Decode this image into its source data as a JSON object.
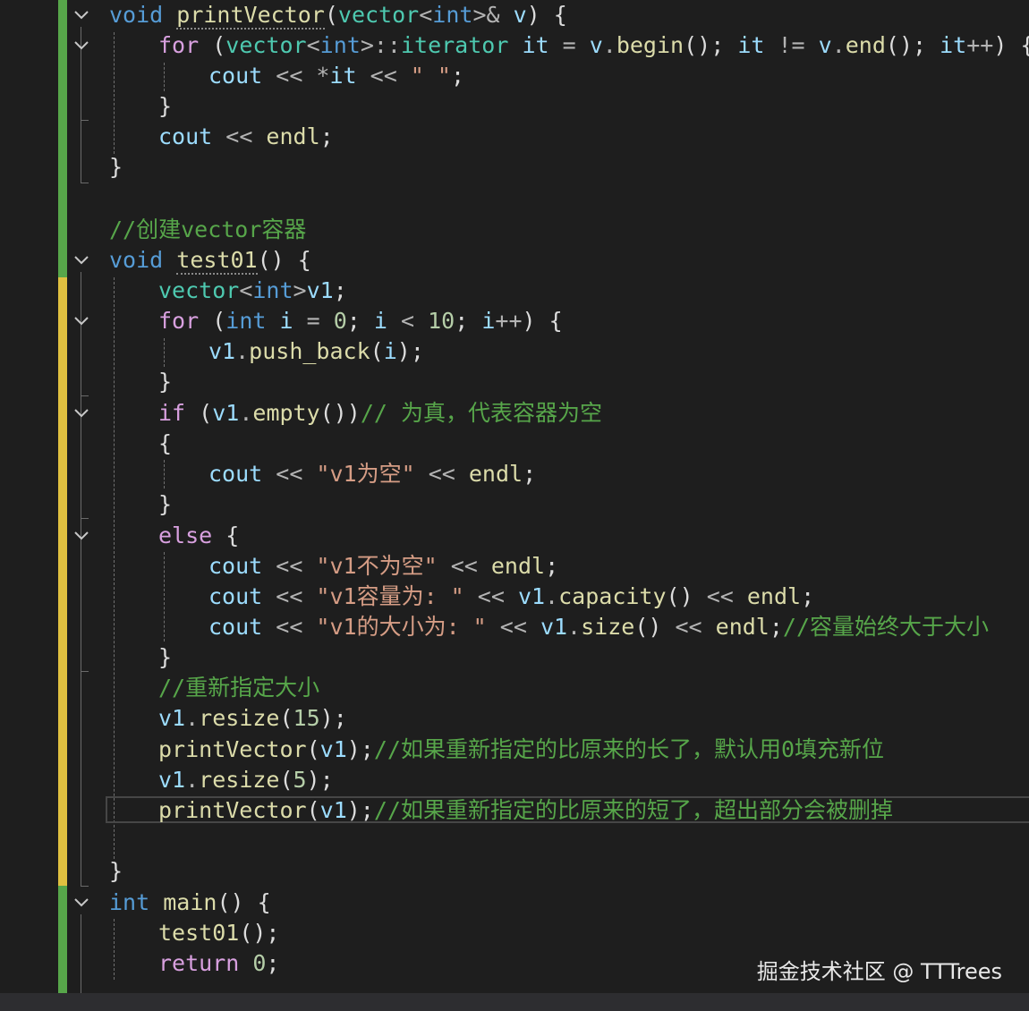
{
  "editor": {
    "lines": [
      [
        [
          "kw",
          "void "
        ],
        [
          "fn",
          "printVector"
        ],
        [
          "pl",
          "("
        ],
        [
          "ty",
          "vector"
        ],
        [
          "op",
          "<"
        ],
        [
          "kw",
          "int"
        ],
        [
          "op",
          ">& "
        ],
        [
          "var",
          "v"
        ],
        [
          "pl",
          ") {"
        ]
      ],
      [
        [
          "ctl",
          "for "
        ],
        [
          "pl",
          "("
        ],
        [
          "ty",
          "vector"
        ],
        [
          "op",
          "<"
        ],
        [
          "kw",
          "int"
        ],
        [
          "op",
          ">::"
        ],
        [
          "ty",
          "iterator "
        ],
        [
          "var",
          "it "
        ],
        [
          "op",
          "= "
        ],
        [
          "var",
          "v"
        ],
        [
          "op",
          "."
        ],
        [
          "fn",
          "begin"
        ],
        [
          "pl",
          "(); "
        ],
        [
          "var",
          "it "
        ],
        [
          "op",
          "!= "
        ],
        [
          "var",
          "v"
        ],
        [
          "op",
          "."
        ],
        [
          "fn",
          "end"
        ],
        [
          "pl",
          "(); "
        ],
        [
          "var",
          "it"
        ],
        [
          "op",
          "++"
        ],
        [
          "pl",
          ") {"
        ]
      ],
      [
        [
          "var",
          "cout "
        ],
        [
          "op",
          "<< *"
        ],
        [
          "var",
          "it "
        ],
        [
          "op",
          "<< "
        ],
        [
          "str",
          "\" \""
        ],
        [
          "pl",
          ";"
        ]
      ],
      [
        [
          "pl",
          "}"
        ]
      ],
      [
        [
          "var",
          "cout "
        ],
        [
          "op",
          "<< "
        ],
        [
          "fn",
          "endl"
        ],
        [
          "pl",
          ";"
        ]
      ],
      [
        [
          "pl",
          "}"
        ]
      ],
      [],
      [
        [
          "cmt",
          "//创建vector容器"
        ]
      ],
      [
        [
          "kw",
          "void "
        ],
        [
          "fn",
          "test01"
        ],
        [
          "pl",
          "() {"
        ]
      ],
      [
        [
          "ty",
          "vector"
        ],
        [
          "op",
          "<"
        ],
        [
          "kw",
          "int"
        ],
        [
          "op",
          ">"
        ],
        [
          "var",
          "v1"
        ],
        [
          "pl",
          ";"
        ]
      ],
      [
        [
          "ctl",
          "for "
        ],
        [
          "pl",
          "("
        ],
        [
          "kw",
          "int "
        ],
        [
          "var",
          "i "
        ],
        [
          "op",
          "= "
        ],
        [
          "num",
          "0"
        ],
        [
          "pl",
          "; "
        ],
        [
          "var",
          "i "
        ],
        [
          "op",
          "< "
        ],
        [
          "num",
          "10"
        ],
        [
          "pl",
          "; "
        ],
        [
          "var",
          "i"
        ],
        [
          "op",
          "++"
        ],
        [
          "pl",
          ") {"
        ]
      ],
      [
        [
          "var",
          "v1"
        ],
        [
          "op",
          "."
        ],
        [
          "fn",
          "push_back"
        ],
        [
          "pl",
          "("
        ],
        [
          "var",
          "i"
        ],
        [
          "pl",
          ");"
        ]
      ],
      [
        [
          "pl",
          "}"
        ]
      ],
      [
        [
          "ctl",
          "if "
        ],
        [
          "pl",
          "("
        ],
        [
          "var",
          "v1"
        ],
        [
          "op",
          "."
        ],
        [
          "fn",
          "empty"
        ],
        [
          "pl",
          "())"
        ],
        [
          "cmt",
          "// 为真，代表容器为空"
        ]
      ],
      [
        [
          "pl",
          "{"
        ]
      ],
      [
        [
          "var",
          "cout "
        ],
        [
          "op",
          "<< "
        ],
        [
          "str",
          "\"v1为空\" "
        ],
        [
          "op",
          "<< "
        ],
        [
          "fn",
          "endl"
        ],
        [
          "pl",
          ";"
        ]
      ],
      [
        [
          "pl",
          "}"
        ]
      ],
      [
        [
          "ctl",
          "else "
        ],
        [
          "pl",
          "{"
        ]
      ],
      [
        [
          "var",
          "cout "
        ],
        [
          "op",
          "<< "
        ],
        [
          "str",
          "\"v1不为空\" "
        ],
        [
          "op",
          "<< "
        ],
        [
          "fn",
          "endl"
        ],
        [
          "pl",
          ";"
        ]
      ],
      [
        [
          "var",
          "cout "
        ],
        [
          "op",
          "<< "
        ],
        [
          "str",
          "\"v1容量为: \" "
        ],
        [
          "op",
          "<< "
        ],
        [
          "var",
          "v1"
        ],
        [
          "op",
          "."
        ],
        [
          "fn",
          "capacity"
        ],
        [
          "pl",
          "() "
        ],
        [
          "op",
          "<< "
        ],
        [
          "fn",
          "endl"
        ],
        [
          "pl",
          ";"
        ]
      ],
      [
        [
          "var",
          "cout "
        ],
        [
          "op",
          "<< "
        ],
        [
          "str",
          "\"v1的大小为: \" "
        ],
        [
          "op",
          "<< "
        ],
        [
          "var",
          "v1"
        ],
        [
          "op",
          "."
        ],
        [
          "fn",
          "size"
        ],
        [
          "pl",
          "() "
        ],
        [
          "op",
          "<< "
        ],
        [
          "fn",
          "endl"
        ],
        [
          "pl",
          ";"
        ],
        [
          "cmt",
          "//容量始终大于大小"
        ]
      ],
      [
        [
          "pl",
          "}"
        ]
      ],
      [
        [
          "cmt",
          "//重新指定大小"
        ]
      ],
      [
        [
          "var",
          "v1"
        ],
        [
          "op",
          "."
        ],
        [
          "fn",
          "resize"
        ],
        [
          "pl",
          "("
        ],
        [
          "num",
          "15"
        ],
        [
          "pl",
          ");"
        ]
      ],
      [
        [
          "fn",
          "printVector"
        ],
        [
          "pl",
          "("
        ],
        [
          "var",
          "v1"
        ],
        [
          "pl",
          ");"
        ],
        [
          "cmt",
          "//如果重新指定的比原来的长了，默认用0填充新位"
        ]
      ],
      [
        [
          "var",
          "v1"
        ],
        [
          "op",
          "."
        ],
        [
          "fn",
          "resize"
        ],
        [
          "pl",
          "("
        ],
        [
          "num",
          "5"
        ],
        [
          "pl",
          ");"
        ]
      ],
      [
        [
          "fn",
          "printVector"
        ],
        [
          "pl",
          "("
        ],
        [
          "var",
          "v1"
        ],
        [
          "pl",
          ");"
        ],
        [
          "cmt",
          "//如果重新指定的比原来的短了，超出部分会被删掉"
        ]
      ],
      [],
      [
        [
          "pl",
          "}"
        ]
      ],
      [
        [
          "kw",
          "int "
        ],
        [
          "fn",
          "main"
        ],
        [
          "pl",
          "() {"
        ]
      ],
      [
        [
          "fn",
          "test01"
        ],
        [
          "pl",
          "();"
        ]
      ],
      [
        [
          "ctl",
          "return "
        ],
        [
          "num",
          "0"
        ],
        [
          "pl",
          ";"
        ]
      ]
    ],
    "colors": {
      "background": "#1e1e1e",
      "saved_change_bar": "#57a64a",
      "unsaved_change_bar": "#e0c040"
    }
  },
  "watermark": "掘金技术社区 @ TTTrees"
}
